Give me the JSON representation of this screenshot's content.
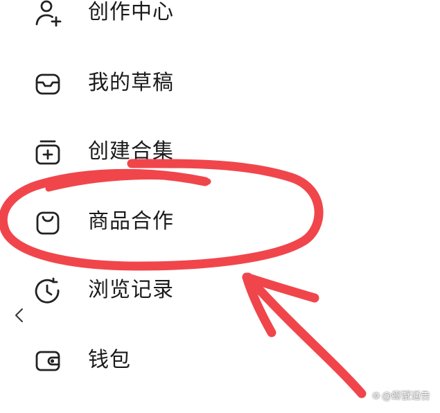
{
  "menu": {
    "items": [
      {
        "label": "创作中心",
        "icon": "creator-person-sparkle-icon"
      },
      {
        "label": "我的草稿",
        "icon": "drafts-tray-icon"
      },
      {
        "label": "创建合集",
        "icon": "add-collection-icon"
      },
      {
        "label": "商品合作",
        "icon": "shopping-bag-icon"
      },
      {
        "label": "浏览记录",
        "icon": "history-clock-icon"
      },
      {
        "label": "钱包",
        "icon": "wallet-icon"
      }
    ]
  },
  "navigation": {
    "back_icon": "chevron-left-icon"
  },
  "annotation": {
    "color": "#f0464b",
    "highlighted_item": "商品合作"
  },
  "watermark": {
    "logo": "☸",
    "text": "@蟛蟹通告"
  }
}
